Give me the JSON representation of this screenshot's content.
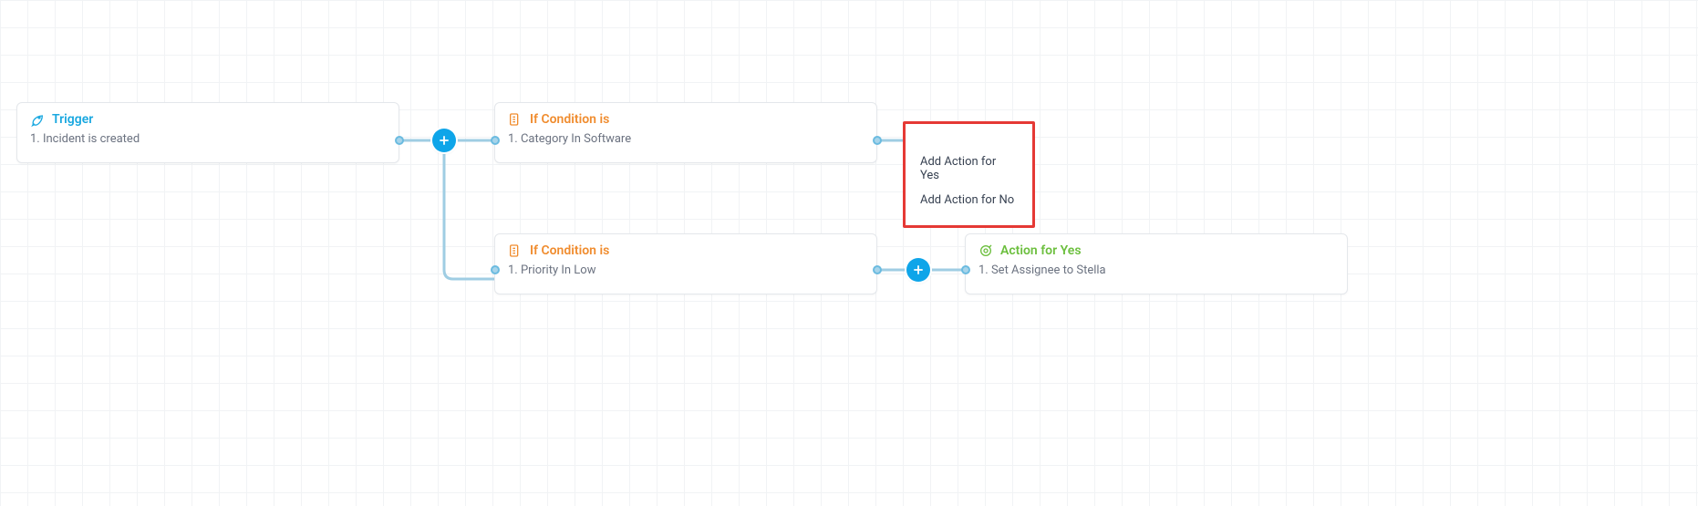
{
  "nodes": {
    "trigger": {
      "title": "Trigger",
      "body": "1. Incident is created"
    },
    "condition1": {
      "title": "If Condition is",
      "body": "1. Category In Software"
    },
    "condition2": {
      "title": "If Condition is",
      "body": "1. Priority In Low"
    },
    "action1": {
      "title": "Action for Yes",
      "body": "1. Set Assignee to Stella"
    }
  },
  "popup": {
    "item1": "Add Action for Yes",
    "item2": "Add Action for No"
  }
}
